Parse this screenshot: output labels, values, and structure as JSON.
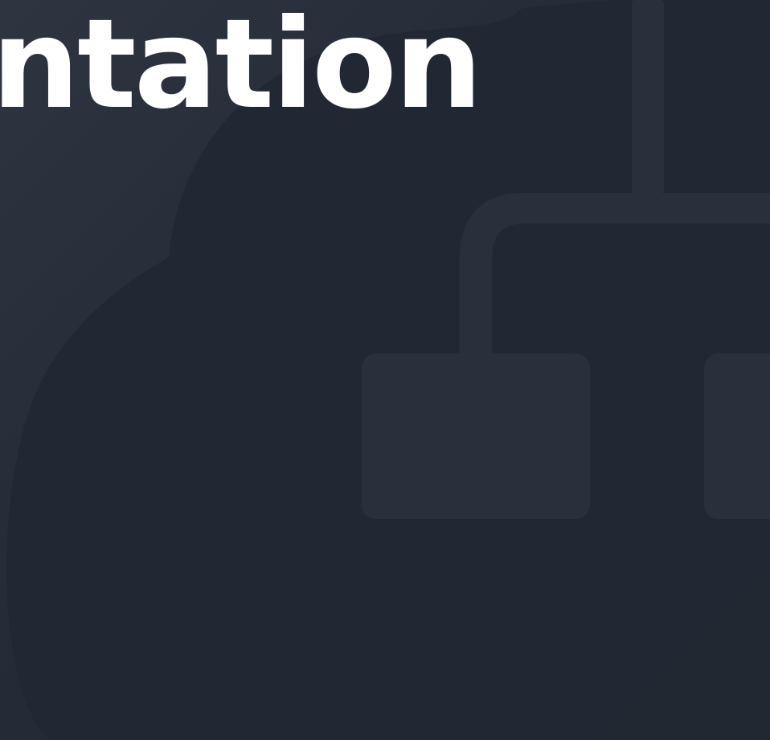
{
  "hero": {
    "title": "entation"
  },
  "background": {
    "icons": [
      "cloud-icon",
      "network-diagram-icon"
    ],
    "colors": {
      "base": "#232935",
      "cloud": "#222833",
      "diagram": "#2a303b"
    }
  }
}
